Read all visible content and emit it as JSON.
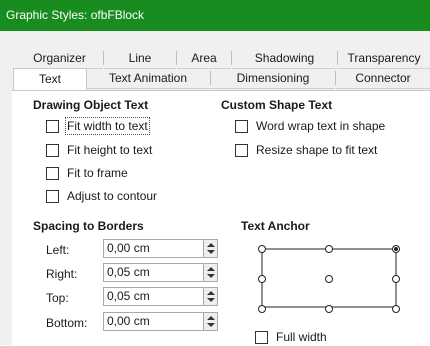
{
  "window": {
    "title": "Graphic Styles: ofbFBlock"
  },
  "tabs_row1": [
    "Organizer",
    "Line",
    "Area",
    "Shadowing",
    "Transparency"
  ],
  "tabs_row2": [
    "Text",
    "Text Animation",
    "Dimensioning",
    "Connector"
  ],
  "active_tab": "Text",
  "drawing_object_text": {
    "heading": "Drawing Object Text",
    "options": [
      {
        "label": "Fit width to text",
        "checked": false
      },
      {
        "label": "Fit height to text",
        "checked": false
      },
      {
        "label": "Fit to frame",
        "checked": false
      },
      {
        "label": "Adjust to contour",
        "checked": false
      }
    ]
  },
  "custom_shape_text": {
    "heading": "Custom Shape Text",
    "options": [
      {
        "label": "Word wrap text in shape",
        "checked": false
      },
      {
        "label": "Resize shape to fit text",
        "checked": false
      }
    ]
  },
  "spacing": {
    "heading": "Spacing to Borders",
    "fields": [
      {
        "label": "Left:",
        "value": "0,00 cm"
      },
      {
        "label": "Right:",
        "value": "0,05 cm"
      },
      {
        "label": "Top:",
        "value": "0,05 cm"
      },
      {
        "label": "Bottom:",
        "value": "0,00 cm"
      }
    ]
  },
  "text_anchor": {
    "heading": "Text Anchor",
    "selected": "top-right",
    "full_width_label": "Full width",
    "full_width_checked": false
  },
  "colors": {
    "titlebar": "#188c1e",
    "panel": "#f0f0f0"
  }
}
